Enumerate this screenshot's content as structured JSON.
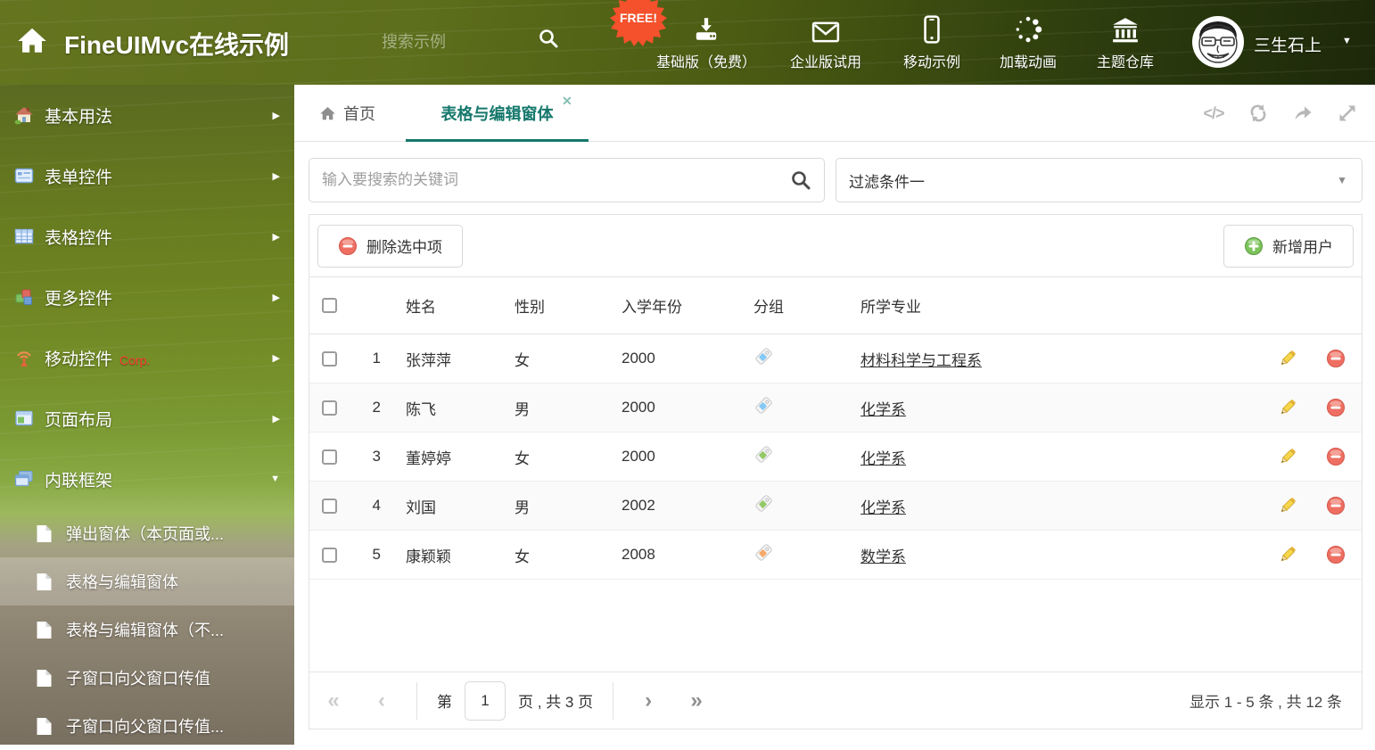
{
  "header": {
    "logo": "FineUIMvc在线示例",
    "search_placeholder": "搜索示例",
    "free_badge": "FREE!",
    "nav": [
      {
        "icon": "download-icon",
        "label": "基础版（免费）"
      },
      {
        "icon": "mail-icon",
        "label": "企业版试用"
      },
      {
        "icon": "mobile-icon",
        "label": "移动示例"
      },
      {
        "icon": "spinner-icon",
        "label": "加载动画"
      },
      {
        "icon": "bank-icon",
        "label": "主题仓库"
      }
    ],
    "user": "三生石上"
  },
  "sidebar": {
    "items": [
      {
        "icon": "home-icon",
        "label": "基本用法",
        "state": "collapsed"
      },
      {
        "icon": "form-icon",
        "label": "表单控件",
        "state": "collapsed"
      },
      {
        "icon": "grid-icon",
        "label": "表格控件",
        "state": "collapsed"
      },
      {
        "icon": "cubes-icon",
        "label": "更多控件",
        "state": "collapsed"
      },
      {
        "icon": "antenna-icon",
        "label": "移动控件",
        "badge": "Corp.",
        "state": "collapsed"
      },
      {
        "icon": "layout-icon",
        "label": "页面布局",
        "state": "collapsed"
      },
      {
        "icon": "frames-icon",
        "label": "内联框架",
        "state": "expanded"
      }
    ],
    "subitems": [
      {
        "label": "弹出窗体（本页面或...",
        "selected": false
      },
      {
        "label": "表格与编辑窗体",
        "selected": true
      },
      {
        "label": "表格与编辑窗体（不...",
        "selected": false
      },
      {
        "label": "子窗口向父窗口传值",
        "selected": false
      },
      {
        "label": "子窗口向父窗口传值...",
        "selected": false
      }
    ]
  },
  "tabs": {
    "home_label": "首页",
    "active_label": "表格与编辑窗体"
  },
  "search_bar": {
    "keyword_placeholder": "输入要搜索的关键词",
    "filter_value": "过滤条件一"
  },
  "toolbar": {
    "delete_label": "删除选中项",
    "add_label": "新增用户"
  },
  "table": {
    "headers": {
      "name": "姓名",
      "gender": "性别",
      "year": "入学年份",
      "group": "分组",
      "major": "所学专业"
    },
    "rows": [
      {
        "num": "1",
        "name": "张萍萍",
        "gender": "女",
        "year": "2000",
        "tag_color": "#85C8F5",
        "major": "材料科学与工程系"
      },
      {
        "num": "2",
        "name": "陈飞",
        "gender": "男",
        "year": "2000",
        "tag_color": "#85C8F5",
        "major": "化学系"
      },
      {
        "num": "3",
        "name": "董婷婷",
        "gender": "女",
        "year": "2000",
        "tag_color": "#92C966",
        "major": "化学系"
      },
      {
        "num": "4",
        "name": "刘国",
        "gender": "男",
        "year": "2002",
        "tag_color": "#92C966",
        "major": "化学系"
      },
      {
        "num": "5",
        "name": "康颖颖",
        "gender": "女",
        "year": "2008",
        "tag_color": "#F6A96B",
        "major": "数学系"
      }
    ]
  },
  "pagination": {
    "page_label_prefix": "第",
    "page_value": "1",
    "page_label_suffix": "页 , 共 3 页",
    "summary": "显示 1 - 5 条 , 共 12 条"
  },
  "glyphs": {
    "arrow_right": "▶",
    "caret_down": "▼",
    "close_tab": "✕",
    "pager_first": "«",
    "pager_prev": "‹",
    "pager_next": "›",
    "pager_last": "»",
    "code_icon": "</>"
  },
  "colors": {
    "accent_teal": "#15786C",
    "tag_blue": "#85C8F5",
    "tag_green": "#92C966",
    "tag_orange": "#F6A96B"
  }
}
